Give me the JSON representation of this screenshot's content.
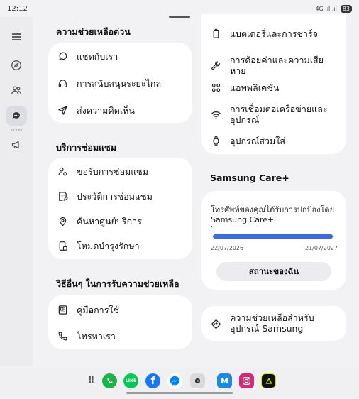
{
  "status_bar": {
    "time": "12:12",
    "signal": "4G .ıl .ıl",
    "battery": "83"
  },
  "left_panel": {
    "urgent_help": {
      "title": "ความช่วยเหลือด่วน",
      "items": [
        "แชทกับเรา",
        "การสนับสนุนระยะไกล",
        "ส่งความคิดเห็น"
      ]
    },
    "repair_service": {
      "title": "บริการซ่อมแซม",
      "items": [
        "ขอรับการซ่อมแซม",
        "ประวัติการซ่อมแซม",
        "ค้นหาศูนย์บริการ",
        "โหมดบำรุงรักษา"
      ]
    },
    "other_help": {
      "title": "วิธีอื่นๆ ในการรับความช่วยเหลือ",
      "items": [
        "คู่มือการใช้",
        "โทรหาเรา"
      ]
    }
  },
  "right_panel": {
    "topics": [
      "แบตเตอรี่และการชาร์จ",
      "การด้อยค่าและความเสียหาย",
      "แอพพลิเคชั่น",
      "การเชื่อมต่อเครือข่ายและ",
      "อุปกรณ์",
      "อุปกรณ์สวมใส่"
    ],
    "care_plus": {
      "title": "Samsung Care+",
      "description": "โทรศัพท์ของคุณได้รับการปกป้องโดย",
      "brand": "Samsung Care+",
      "progress_mark": "’",
      "progress": 0.99,
      "start_date": "22/07/2026",
      "end_date": "21/07/2027",
      "button": "สถานะของฉัน"
    },
    "device_help": {
      "line1": "ความช่วยเหลือสำหรับ",
      "line2": "อุปกรณ์ Samsung"
    }
  },
  "dock": {
    "apps": [
      "app-drawer",
      "phone",
      "line",
      "facebook",
      "messenger",
      "camera",
      "samsung-members",
      "instagram",
      "true-id"
    ],
    "colors": {
      "phone": "#1bb34a",
      "line": "#06c755",
      "facebook": "#1877f2",
      "messenger": "#0084ff",
      "members": "#1e88e5",
      "instagram": "#d62976",
      "trueid": "#111111",
      "accent": "#3e6cdc"
    }
  }
}
